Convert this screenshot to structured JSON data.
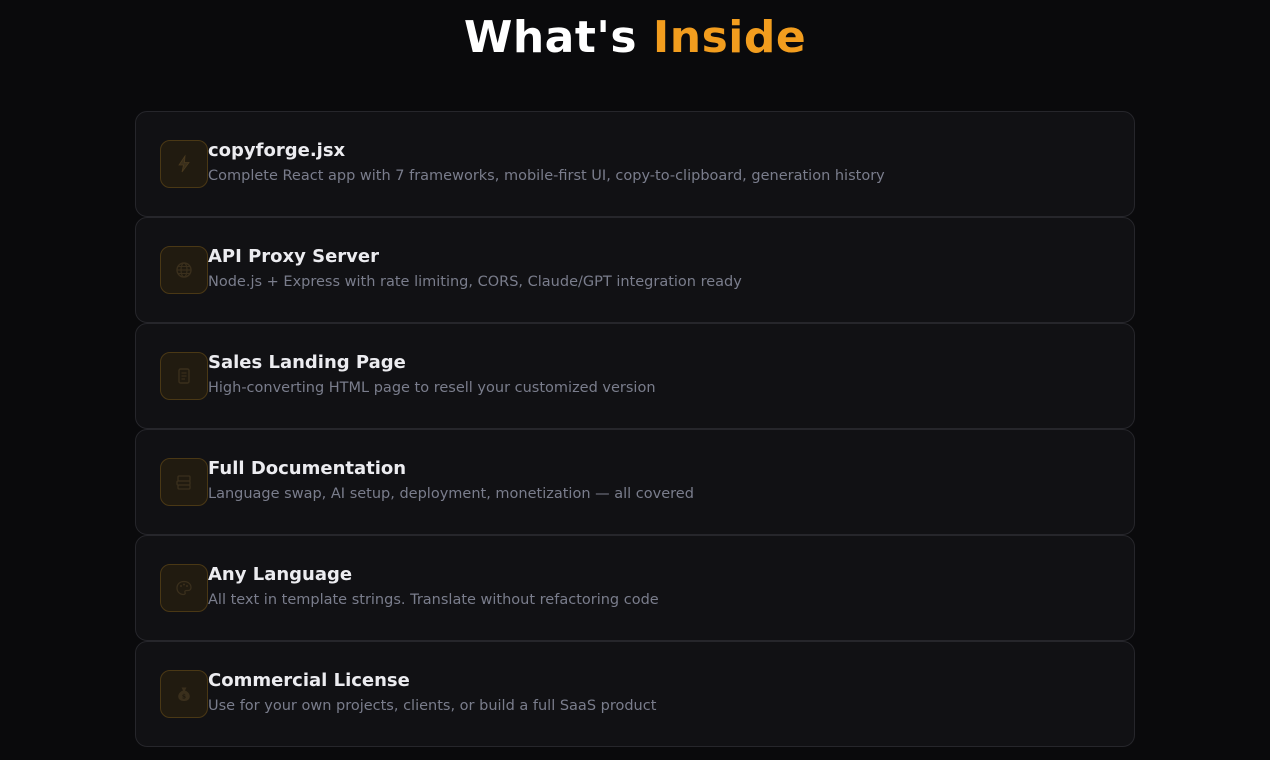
{
  "heading": {
    "text_main": "What's ",
    "text_accent": "Inside",
    "accent_color": "#f29d1e"
  },
  "items": [
    {
      "title": "copyforge.jsx",
      "description": "Complete React app with 7 frameworks, mobile-first UI, copy-to-clipboard, generation history",
      "icon": "lightning-icon"
    },
    {
      "title": "API Proxy Server",
      "description": "Node.js + Express with rate limiting, CORS, Claude/GPT integration ready",
      "icon": "globe-icon"
    },
    {
      "title": "Sales Landing Page",
      "description": "High-converting HTML page to resell your customized version",
      "icon": "page-icon"
    },
    {
      "title": "Full Documentation",
      "description": "Language swap, AI setup, deployment, monetization — all covered",
      "icon": "books-icon"
    },
    {
      "title": "Any Language",
      "description": "All text in template strings. Translate without refactoring code",
      "icon": "palette-icon"
    },
    {
      "title": "Commercial License",
      "description": "Use for your own projects, clients, or build a full SaaS product",
      "icon": "money-bag-icon"
    }
  ]
}
